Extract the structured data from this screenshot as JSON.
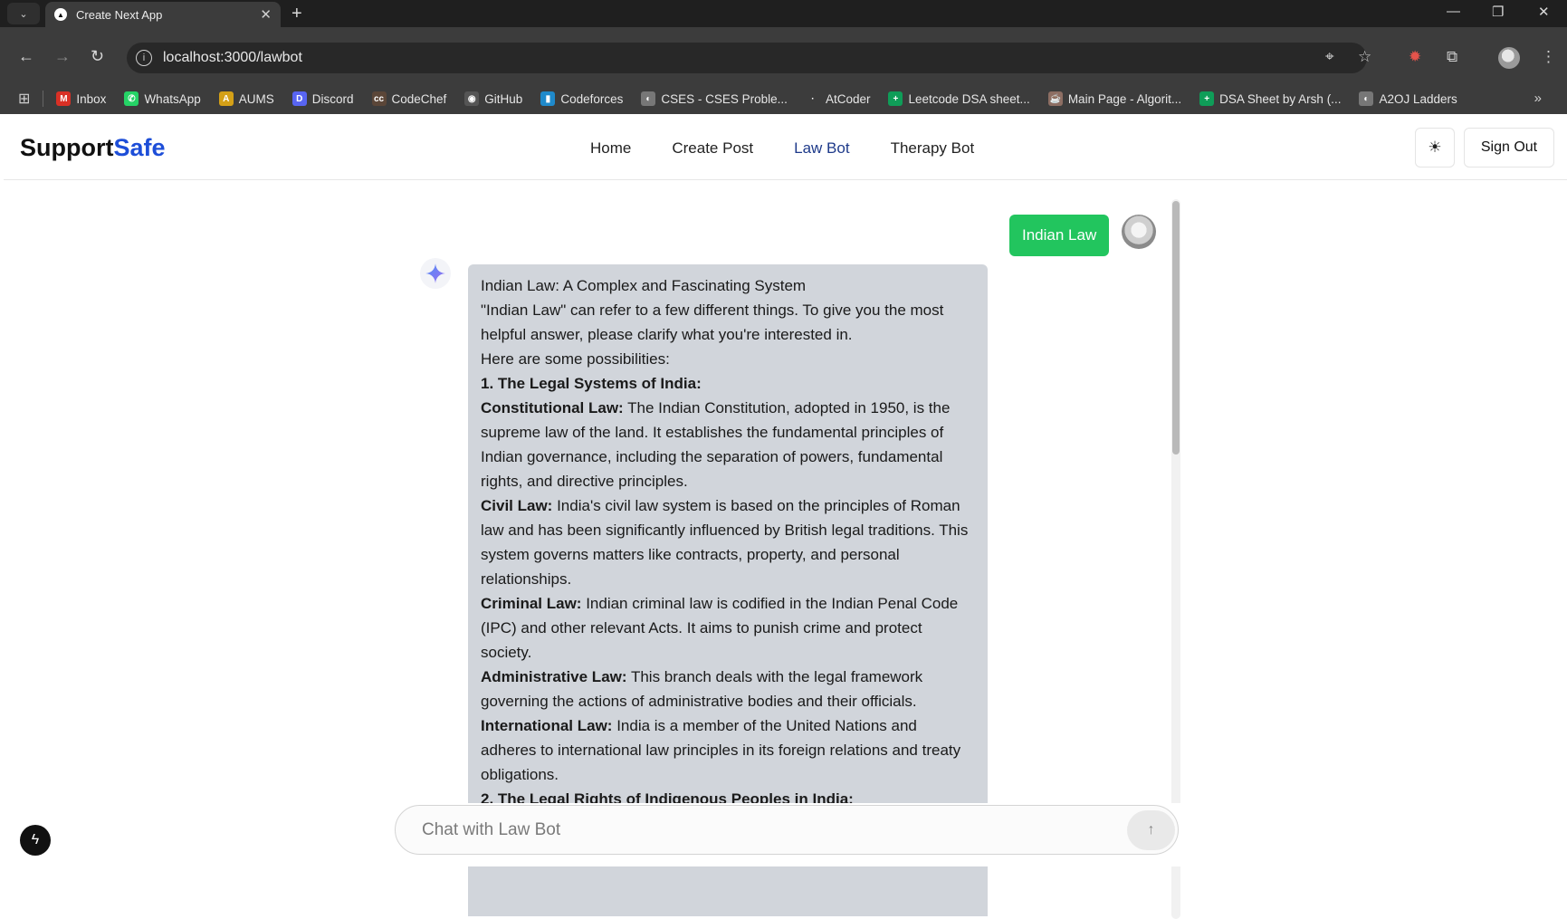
{
  "browser": {
    "tab_title": "Create Next App",
    "url": "localhost:3000/lawbot",
    "bookmarks": [
      {
        "label": "Inbox",
        "color": "#d93025",
        "glyph": "M"
      },
      {
        "label": "WhatsApp",
        "color": "#25d366",
        "glyph": "✆"
      },
      {
        "label": "AUMS",
        "color": "#d4a017",
        "glyph": "A"
      },
      {
        "label": "Discord",
        "color": "#5865f2",
        "glyph": "D"
      },
      {
        "label": "CodeChef",
        "color": "#5b4638",
        "glyph": "cc"
      },
      {
        "label": "GitHub",
        "color": "#555555",
        "glyph": "◉"
      },
      {
        "label": "Codeforces",
        "color": "#1f8acb",
        "glyph": "▮"
      },
      {
        "label": "CSES - CSES Proble...",
        "color": "#777777",
        "glyph": "◐"
      },
      {
        "label": "AtCoder",
        "color": "#3c3c3c",
        "glyph": "·"
      },
      {
        "label": "Leetcode DSA sheet...",
        "color": "#0f9d58",
        "glyph": "+"
      },
      {
        "label": "Main Page - Algorit...",
        "color": "#8d6e63",
        "glyph": "☕"
      },
      {
        "label": "DSA Sheet by Arsh (...",
        "color": "#0f9d58",
        "glyph": "+"
      },
      {
        "label": "A2OJ Ladders",
        "color": "#777777",
        "glyph": "◐"
      }
    ]
  },
  "navbar": {
    "brand_primary": "Support",
    "brand_accent": "Safe",
    "links": [
      "Home",
      "Create Post",
      "Law Bot",
      "Therapy Bot"
    ],
    "active_link": "Law Bot",
    "theme_icon": "sun-icon",
    "sign_out_label": "Sign Out"
  },
  "chat": {
    "user_message": "Indian Law",
    "bot_message": [
      {
        "bold": "",
        "text": "Indian Law: A Complex and Fascinating System"
      },
      {
        "bold": "",
        "text": "\"Indian Law\" can refer to a few different things. To give you the most helpful answer, please clarify what you're interested in."
      },
      {
        "bold": "",
        "text": "Here are some possibilities:"
      },
      {
        "bold": "1. The Legal Systems of India:",
        "text": ""
      },
      {
        "bold": "Constitutional Law:",
        "text": " The Indian Constitution, adopted in 1950, is the supreme law of the land. It establishes the fundamental principles of Indian governance, including the separation of powers, fundamental rights, and directive principles."
      },
      {
        "bold": "Civil Law:",
        "text": " India's civil law system is based on the principles of Roman law and has been significantly influenced by British legal traditions. This system governs matters like contracts, property, and personal relationships."
      },
      {
        "bold": "Criminal Law:",
        "text": " Indian criminal law is codified in the Indian Penal Code (IPC) and other relevant Acts. It aims to punish crime and protect society."
      },
      {
        "bold": "Administrative Law:",
        "text": " This branch deals with the legal framework governing the actions of administrative bodies and their officials."
      },
      {
        "bold": "International Law:",
        "text": " India is a member of the United Nations and adheres to international law principles in its foreign relations and treaty obligations."
      },
      {
        "bold": "2. The Legal Rights of Indigenous Peoples in India:",
        "text": ""
      }
    ],
    "input_placeholder": "Chat with Law Bot",
    "send_icon": "arrow-up-icon"
  },
  "colors": {
    "accent": "#1d4ed8",
    "user_bubble": "#22c55e",
    "bot_bubble": "#d1d5db"
  }
}
